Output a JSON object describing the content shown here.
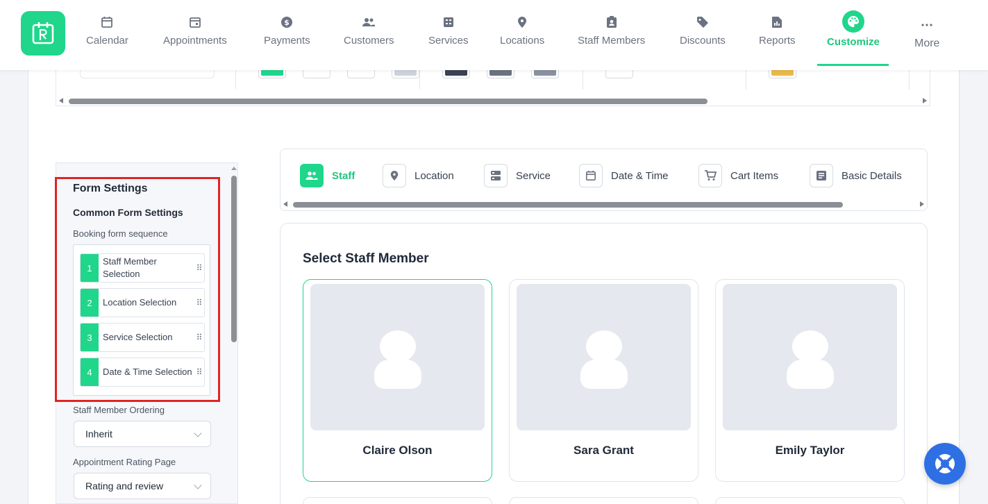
{
  "nav": {
    "items": [
      {
        "label": "Calendar",
        "icon": "calendar-icon"
      },
      {
        "label": "Appointments",
        "icon": "appointment-icon"
      },
      {
        "label": "Payments",
        "icon": "dollar-icon"
      },
      {
        "label": "Customers",
        "icon": "customers-icon"
      },
      {
        "label": "Services",
        "icon": "services-icon"
      },
      {
        "label": "Locations",
        "icon": "location-pin-icon"
      },
      {
        "label": "Staff Members",
        "icon": "staff-badge-icon"
      },
      {
        "label": "Discounts",
        "icon": "tag-icon"
      },
      {
        "label": "Reports",
        "icon": "report-icon"
      },
      {
        "label": "Customize",
        "icon": "palette-icon",
        "active": true
      },
      {
        "label": "More",
        "icon": "more-dots-icon"
      }
    ]
  },
  "colors": {
    "accent": "#1fd68b",
    "highlight_border": "#e02424",
    "help_button": "#2f6fe4",
    "swatches": [
      "#1fd68b",
      "#ffffff",
      "#ffffff",
      "#cdd3dc",
      "#3b4253",
      "#6b7280",
      "#8a92a0",
      "#ffffff",
      "#e9b949"
    ]
  },
  "sidebar": {
    "title": "Form Settings",
    "subtitle": "Common Form Settings",
    "sequence_label": "Booking form sequence",
    "sequence": [
      {
        "num": "1",
        "label": "Staff Member Selection"
      },
      {
        "num": "2",
        "label": "Location Selection"
      },
      {
        "num": "3",
        "label": "Service Selection"
      },
      {
        "num": "4",
        "label": "Date & Time Selection"
      }
    ],
    "staff_ordering_label": "Staff Member Ordering",
    "staff_ordering_value": "Inherit",
    "rating_page_label": "Appointment Rating Page",
    "rating_page_value": "Rating and review"
  },
  "tabs": [
    {
      "label": "Staff",
      "icon": "staff-icon",
      "active": true
    },
    {
      "label": "Location",
      "icon": "location-pin-icon"
    },
    {
      "label": "Service",
      "icon": "service-icon"
    },
    {
      "label": "Date & Time",
      "icon": "calendar-icon"
    },
    {
      "label": "Cart Items",
      "icon": "cart-icon"
    },
    {
      "label": "Basic Details",
      "icon": "details-icon"
    }
  ],
  "content": {
    "title": "Select Staff Member",
    "staff": [
      {
        "name": "Claire Olson",
        "selected": true
      },
      {
        "name": "Sara Grant"
      },
      {
        "name": "Emily Taylor"
      }
    ]
  }
}
